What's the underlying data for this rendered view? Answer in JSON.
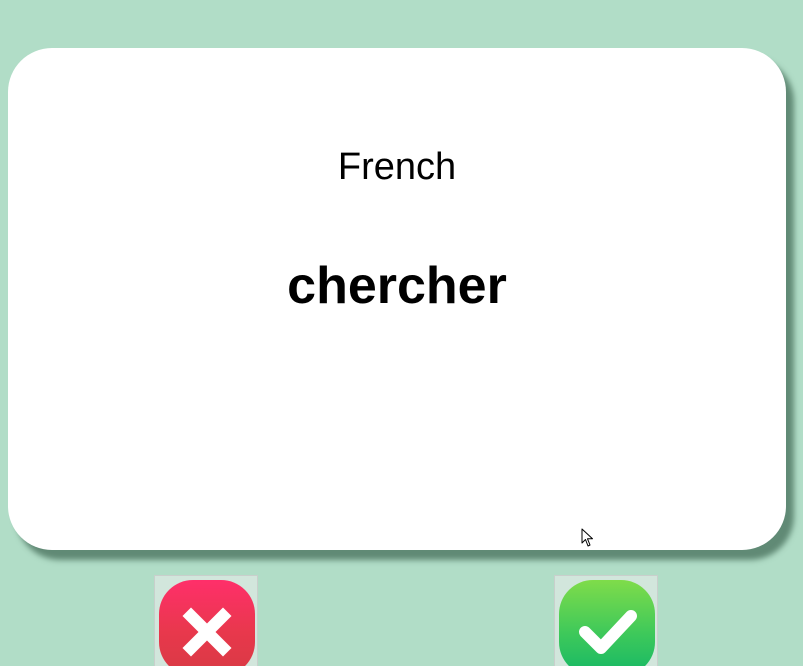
{
  "flashcard": {
    "language": "French",
    "word": "chercher"
  },
  "buttons": {
    "wrong_icon": "x-mark-icon",
    "right_icon": "checkmark-icon"
  },
  "colors": {
    "background": "#b1ddc7",
    "card": "#ffffff",
    "wrong": "#e8384c",
    "right": "#3fc95a"
  }
}
